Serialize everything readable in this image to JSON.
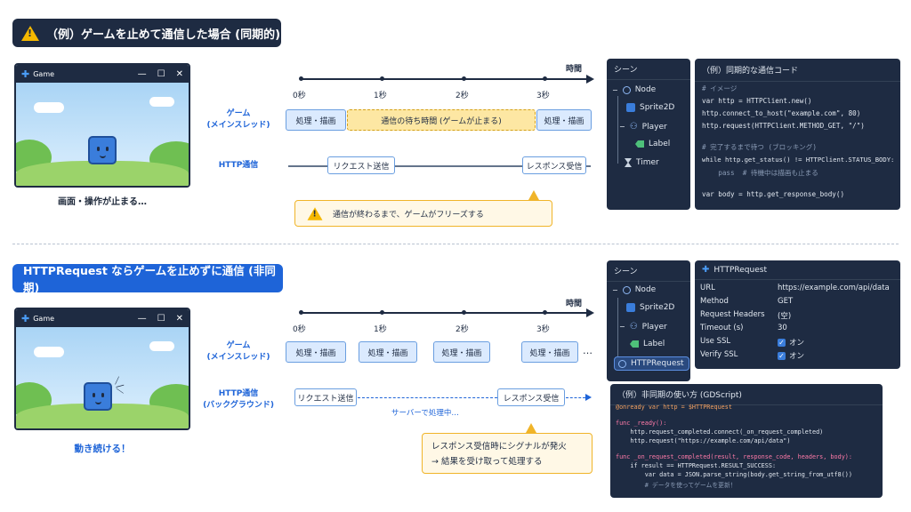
{
  "top": {
    "header": "（例）ゲームを止めて通信した場合 (同期的)",
    "window_title": "Game",
    "caption": "画面・操作が止まる…",
    "timeline": {
      "time_label": "時間",
      "ticks": [
        "0秒",
        "1秒",
        "2秒",
        "3秒"
      ],
      "game_row_label": [
        "ゲーム",
        "(メインスレッド)"
      ],
      "http_row_label": "HTTP通信",
      "process_label": "処理・描画",
      "wait_label": "通信の待ち時間 (ゲームが止まる)",
      "request_label": "リクエスト送信",
      "response_label": "レスポンス受信",
      "callout": "通信が終わるまで、ゲームがフリーズする"
    },
    "scene": {
      "title": "シーン",
      "nodes": [
        "Node",
        "Sprite2D",
        "Player",
        "Label",
        "Timer"
      ]
    },
    "code": {
      "title": "（例）同期的な通信コード",
      "lines": [
        "# イメージ",
        "var http = HTTPClient.new()",
        "http.connect_to_host(\"example.com\", 80)",
        "http.request(HTTPClient.METHOD_GET, \"/\")",
        "",
        "# 完了するまで待つ (ブロッキング)",
        "while http.get_status() != HTTPClient.STATUS_BODY:",
        "    pass  # 待機中は描画も止まる",
        "",
        "var body = http.get_response_body()"
      ]
    }
  },
  "bottom": {
    "header": "HTTPRequest ならゲームを止めずに通信 (非同期)",
    "window_title": "Game",
    "caption": "動き続ける！",
    "timeline": {
      "time_label": "時間",
      "ticks": [
        "0秒",
        "1秒",
        "2秒",
        "3秒"
      ],
      "game_row_label": [
        "ゲーム",
        "(メインスレッド)"
      ],
      "http_row_label": [
        "HTTP通信",
        "(バックグラウンド)"
      ],
      "process_label": "処理・描画",
      "ellipsis": "…",
      "request_label": "リクエスト送信",
      "server_label": "サーバーで処理中…",
      "response_label": "レスポンス受信",
      "callout": [
        "レスポンス受信時にシグナルが発火",
        "→ 結果を受け取って処理する"
      ]
    },
    "scene": {
      "title": "シーン",
      "nodes": [
        "Node",
        "Sprite2D",
        "Player",
        "Label",
        "HTTPRequest"
      ]
    },
    "inspector": {
      "title": "HTTPRequest",
      "rows": [
        {
          "key": "URL",
          "value": "https://example.com/api/data"
        },
        {
          "key": "Method",
          "value": "GET"
        },
        {
          "key": "Request Headers",
          "value": "(空)"
        },
        {
          "key": "Timeout (s)",
          "value": "30"
        },
        {
          "key": "Use SSL",
          "value": "オン"
        },
        {
          "key": "Verify SSL",
          "value": "オン"
        }
      ]
    },
    "code": {
      "title": "（例）非同期の使い方 (GDScript)",
      "lines": [
        "@onready var http = $HTTPRequest",
        "",
        "func _ready():",
        "    http.request_completed.connect(_on_request_completed)",
        "    http.request(\"https://example.com/api/data\")",
        "",
        "func _on_request_completed(result, response_code, headers, body):",
        "    if result == HTTPRequest.RESULT_SUCCESS:",
        "        var data = JSON.parse_string(body.get_string_from_utf8())",
        "        # データを使ってゲームを更新！"
      ]
    }
  },
  "colors": {
    "navy": "#1e2b42",
    "blue": "#1e64d8",
    "warning": "#f5b800",
    "wait_fill": "#fde7a3"
  }
}
